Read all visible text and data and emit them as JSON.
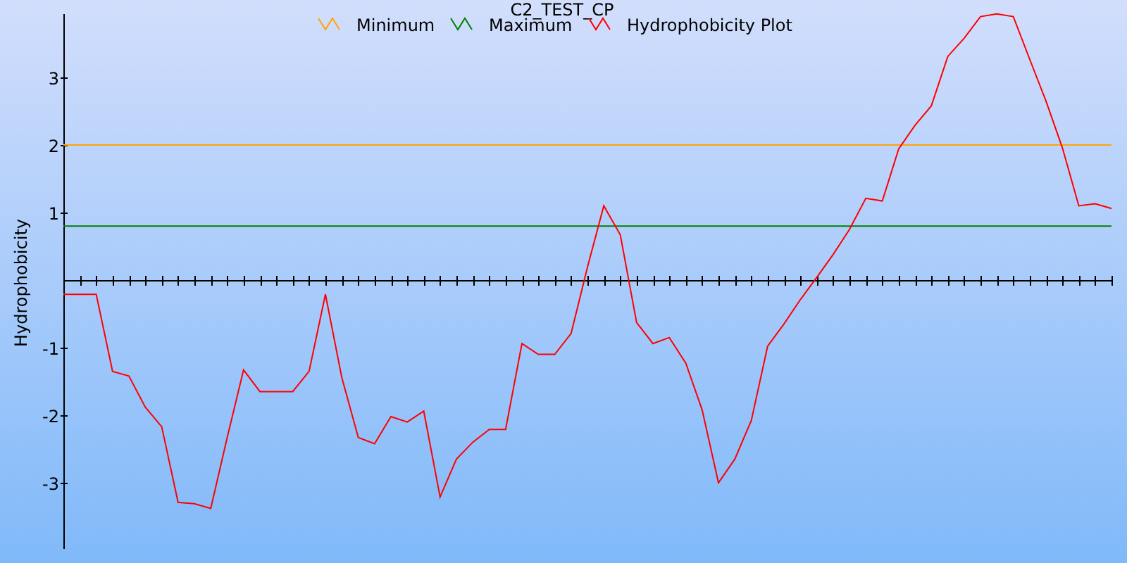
{
  "chart_data": {
    "type": "line",
    "title": "C2_TEST_CP",
    "ylabel": "Hydrophobicity",
    "categories": [
      null,
      null,
      null,
      null,
      null,
      null,
      null,
      null,
      null,
      null,
      null,
      null,
      null,
      null,
      null,
      null,
      null,
      null,
      null,
      null,
      null,
      null,
      null,
      null,
      null,
      null,
      null,
      null,
      null,
      null,
      null,
      null,
      null,
      null,
      null,
      null,
      null,
      null,
      null,
      null,
      null,
      null,
      null,
      null,
      null,
      null,
      null,
      null,
      null,
      null,
      null,
      null,
      null,
      null,
      null,
      null,
      null,
      null,
      null,
      null,
      null,
      null,
      null,
      null,
      null
    ],
    "ylim": [
      -4,
      4
    ],
    "legend": "top",
    "yticks": [
      -3,
      -2,
      -1,
      1,
      2,
      3
    ],
    "series": [
      {
        "name": "Minimum",
        "color": "#ffa500",
        "values": [
          2,
          2,
          2,
          2,
          2,
          2,
          2,
          2,
          2,
          2,
          2,
          2,
          2,
          2,
          2,
          2,
          2,
          2,
          2,
          2,
          2,
          2,
          2,
          2,
          2,
          2,
          2,
          2,
          2,
          2,
          2,
          2,
          2,
          2,
          2,
          2,
          2,
          2,
          2,
          2,
          2,
          2,
          2,
          2,
          2,
          2,
          2,
          2,
          2,
          2,
          2,
          2,
          2,
          2,
          2,
          2,
          2,
          2,
          2,
          2,
          2,
          2,
          2,
          2,
          2
        ]
      },
      {
        "name": "Maximum",
        "color": "#008000",
        "values": [
          0.8,
          0.8,
          0.8,
          0.8,
          0.8,
          0.8,
          0.8,
          0.8,
          0.8,
          0.8,
          0.8,
          0.8,
          0.8,
          0.8,
          0.8,
          0.8,
          0.8,
          0.8,
          0.8,
          0.8,
          0.8,
          0.8,
          0.8,
          0.8,
          0.8,
          0.8,
          0.8,
          0.8,
          0.8,
          0.8,
          0.8,
          0.8,
          0.8,
          0.8,
          0.8,
          0.8,
          0.8,
          0.8,
          0.8,
          0.8,
          0.8,
          0.8,
          0.8,
          0.8,
          0.8,
          0.8,
          0.8,
          0.8,
          0.8,
          0.8,
          0.8,
          0.8,
          0.8,
          0.8,
          0.8,
          0.8,
          0.8,
          0.8,
          0.8,
          0.8,
          0.8,
          0.8,
          0.8,
          0.8,
          0.8
        ]
      },
      {
        "name": "Hydrophobicity Plot",
        "color": "#ff0000",
        "values": [
          -0.21,
          -0.21,
          -0.21,
          -1.35,
          -1.42,
          -1.88,
          -2.17,
          -3.29,
          -3.31,
          -3.38,
          -2.33,
          -1.33,
          -1.65,
          -1.65,
          -1.65,
          -1.35,
          -0.21,
          -1.44,
          -2.33,
          -2.42,
          -2.02,
          -2.1,
          -1.94,
          -3.21,
          -2.65,
          -2.4,
          -2.21,
          -2.21,
          -0.94,
          -1.1,
          -1.1,
          -0.79,
          0.19,
          1.1,
          0.67,
          -0.63,
          -0.94,
          -0.85,
          -1.23,
          -1.92,
          -3.0,
          -2.65,
          -2.08,
          -0.98,
          -0.65,
          -0.29,
          0.04,
          0.38,
          0.75,
          1.21,
          1.17,
          1.94,
          2.29,
          2.58,
          3.31,
          3.58,
          3.9,
          3.94,
          3.9,
          3.27,
          2.65,
          1.96,
          1.1,
          1.13,
          1.06
        ]
      }
    ]
  }
}
